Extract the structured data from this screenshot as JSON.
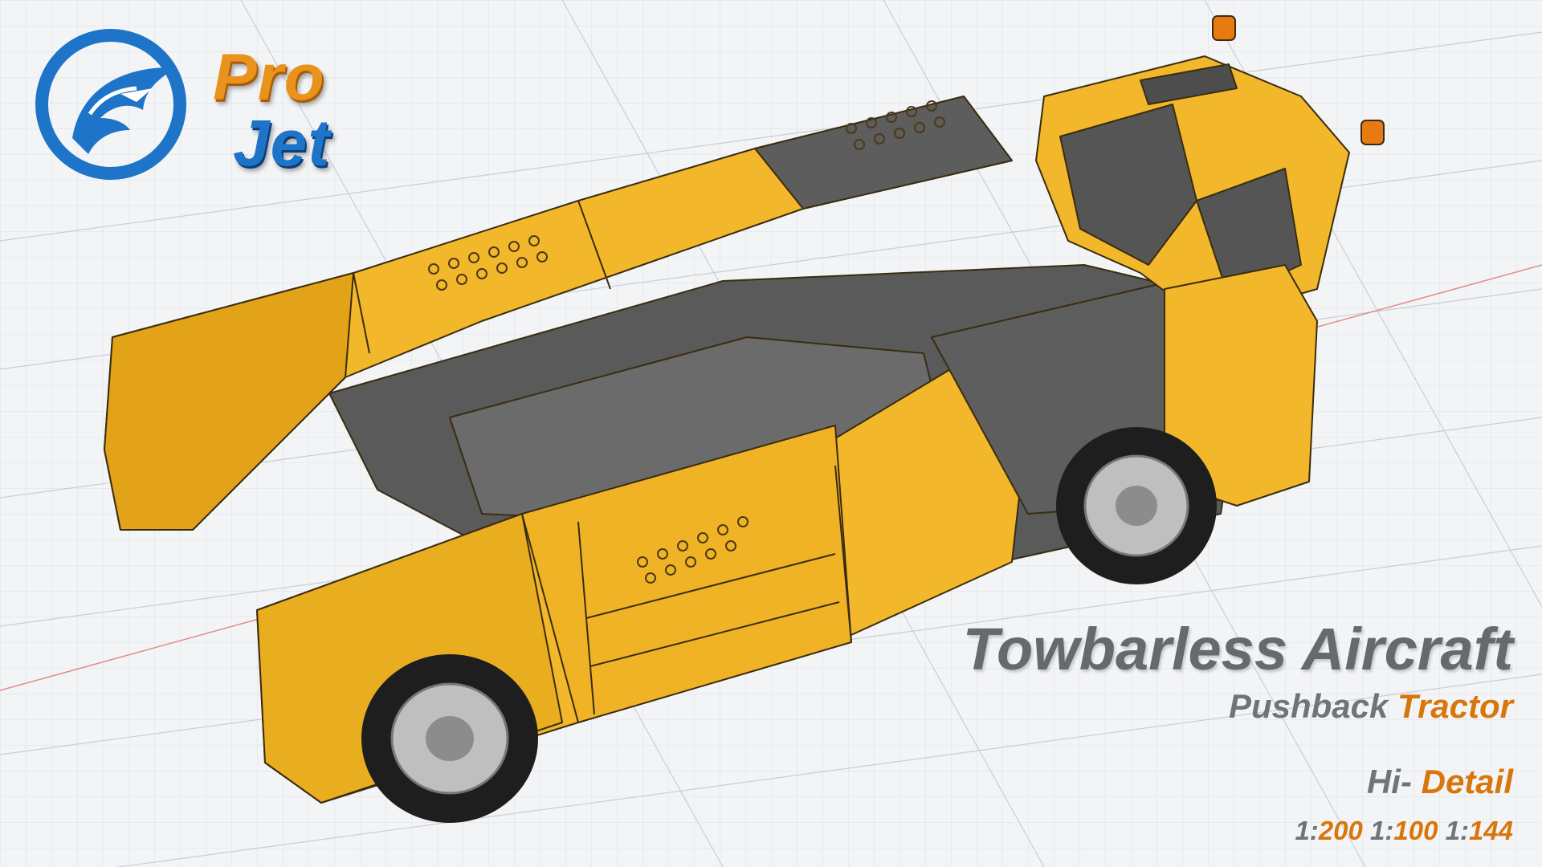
{
  "logo": {
    "line1": "Pro",
    "line2": "Jet",
    "icon": "eagle-head-icon"
  },
  "caption": {
    "title": "Towbarless Aircraft",
    "subtitle_a": "Pushback",
    "subtitle_b": "Tractor",
    "detail_a": "Hi-",
    "detail_b": "Detail",
    "scales": [
      {
        "prefix": "1:",
        "value": "200"
      },
      {
        "prefix": "1:",
        "value": "100"
      },
      {
        "prefix": "1:",
        "value": "144"
      }
    ]
  },
  "colors": {
    "body_yellow": "#f2b72a",
    "body_yellow_dark": "#d99a14",
    "frame_grey": "#4c4c4c",
    "accent_orange": "#d8760c",
    "logo_blue": "#1e74c8",
    "logo_orange": "#e9921c",
    "grid_line": "#cfd3d8",
    "axis_red": "#e26b6b"
  }
}
